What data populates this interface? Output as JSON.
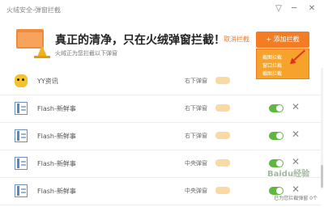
{
  "window": {
    "title": "火绒安全-弹窗拦截",
    "help_icon": "▽",
    "minimize_icon": "─",
    "close_icon": "✕"
  },
  "header": {
    "headline": "真正的清净，只在火绒弹窗拦截！",
    "subline": "火绒正为您拦截以下弹窗",
    "cancel_label": "取消拦截",
    "add_button": "+ 添加拦截",
    "dropdown": [
      "截图拦截",
      "窗口拦截",
      "截图拦截"
    ]
  },
  "rows": [
    {
      "name": "YY资讯",
      "position": "右下弹窗",
      "icon": "yy-icon"
    },
    {
      "name": "Flash-新鲜事",
      "position": "右下弹窗",
      "icon": "flash-icon"
    },
    {
      "name": "Flash-新鲜事",
      "position": "右下弹窗",
      "icon": "flash-icon"
    },
    {
      "name": "Flash-新鲜事",
      "position": "中央弹窗",
      "icon": "flash-icon"
    },
    {
      "name": "Flash-新鲜事",
      "position": "中央弹窗",
      "icon": "flash-icon"
    }
  ],
  "watermark": "Baidu经验",
  "footer": "已为您拦截弹窗 0个",
  "colors": {
    "accent": "#f47d23",
    "dropdown": "#f5a32a",
    "toggle_on": "#5fb742",
    "arrow": "#e0331f"
  }
}
